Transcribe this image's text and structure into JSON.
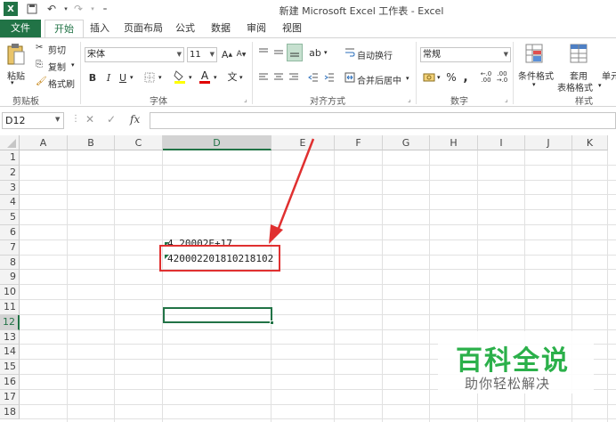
{
  "window": {
    "title": "新建 Microsoft Excel 工作表 - Excel"
  },
  "tabs": [
    "文件",
    "开始",
    "插入",
    "页面布局",
    "公式",
    "数据",
    "审阅",
    "视图"
  ],
  "clipboard": {
    "paste": "粘贴",
    "cut": "剪切",
    "copy": "复制",
    "format_painter": "格式刷",
    "group": "剪贴板"
  },
  "font": {
    "name": "宋体",
    "size": "11",
    "bold": "B",
    "italic": "I",
    "underline": "U",
    "grow": "A",
    "shrink": "A",
    "wen": "文",
    "group": "字体"
  },
  "alignment": {
    "wrap": "自动换行",
    "merge": "合并后居中",
    "group": "对齐方式"
  },
  "number": {
    "format": "常规",
    "percent": "%",
    "comma": ",",
    "group": "数字"
  },
  "styles": {
    "conditional": "条件格式",
    "table_format_1": "套用",
    "table_format_2": "表格格式",
    "cell_styles": "单元",
    "group": "样式"
  },
  "formula_bar": {
    "name_box": "D12",
    "fx": "fx"
  },
  "columns": [
    "A",
    "B",
    "C",
    "D",
    "E",
    "F",
    "G",
    "H",
    "I",
    "J",
    "K"
  ],
  "rows": [
    "1",
    "2",
    "3",
    "4",
    "5",
    "6",
    "7",
    "8",
    "9",
    "10",
    "11",
    "12",
    "13",
    "14",
    "15",
    "16",
    "17",
    "18"
  ],
  "cells": {
    "D7": "4.20002E+17",
    "D8": "420002201810218102"
  },
  "watermark": {
    "main": "百科全说",
    "sub": "助你轻松解决"
  },
  "colors": {
    "accent": "#217346",
    "annotation": "#e03030"
  }
}
